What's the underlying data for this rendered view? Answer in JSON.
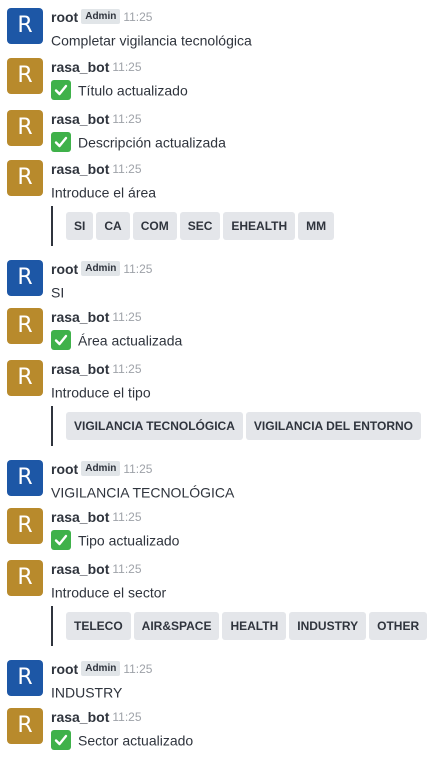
{
  "check_icon_color": "#3fb14a",
  "avatar_colors": {
    "root": "#1d57a6",
    "rasa_bot": "#b88a2c"
  },
  "messages": [
    {
      "avatar": "R",
      "user": "root",
      "role": "Admin",
      "time": "11:25",
      "text": "Completar vigilancia tecnológica"
    },
    {
      "avatar": "R",
      "user": "rasa_bot",
      "time": "11:25",
      "text": "Título actualizado",
      "icon": "check-mark-icon"
    },
    {
      "avatar": "R",
      "user": "rasa_bot",
      "time": "11:25",
      "text": "Descripción actualizada",
      "icon": "check-mark-icon"
    },
    {
      "avatar": "R",
      "user": "rasa_bot",
      "time": "11:25",
      "text": "Introduce el área",
      "buttons": [
        "SI",
        "CA",
        "COM",
        "SEC",
        "EHEALTH",
        "MM"
      ]
    },
    {
      "avatar": "R",
      "user": "root",
      "role": "Admin",
      "time": "11:25",
      "text": "SI"
    },
    {
      "avatar": "R",
      "user": "rasa_bot",
      "time": "11:25",
      "text": "Área actualizada",
      "icon": "check-mark-icon"
    },
    {
      "avatar": "R",
      "user": "rasa_bot",
      "time": "11:25",
      "text": "Introduce el tipo",
      "buttons": [
        "VIGILANCIA TECNOLÓGICA",
        "VIGILANCIA DEL ENTORNO"
      ]
    },
    {
      "avatar": "R",
      "user": "root",
      "role": "Admin",
      "time": "11:25",
      "text": "VIGILANCIA TECNOLÓGICA"
    },
    {
      "avatar": "R",
      "user": "rasa_bot",
      "time": "11:25",
      "text": "Tipo actualizado",
      "icon": "check-mark-icon"
    },
    {
      "avatar": "R",
      "user": "rasa_bot",
      "time": "11:25",
      "text": "Introduce el sector",
      "buttons": [
        "TELECO",
        "AIR&SPACE",
        "HEALTH",
        "INDUSTRY",
        "OTHER"
      ]
    },
    {
      "avatar": "R",
      "user": "root",
      "role": "Admin",
      "time": "11:25",
      "text": "INDUSTRY"
    },
    {
      "avatar": "R",
      "user": "rasa_bot",
      "time": "11:25",
      "text": "Sector actualizado",
      "icon": "check-mark-icon"
    }
  ]
}
